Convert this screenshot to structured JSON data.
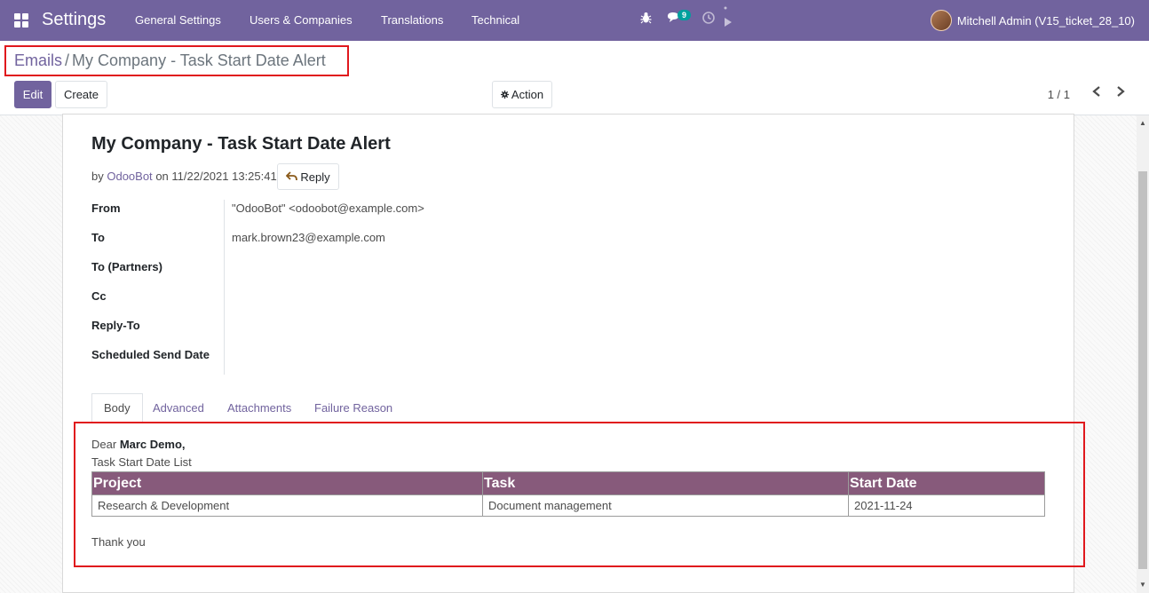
{
  "navbar": {
    "app_title": "Settings",
    "menu": [
      "General Settings",
      "Users & Companies",
      "Translations",
      "Technical"
    ],
    "chat_badge": "9",
    "user_name": "Mitchell Admin (V15_ticket_28_10)",
    "bg_color": "#71639e"
  },
  "breadcrumb": {
    "parent": "Emails",
    "separator": "/",
    "current": "My Company - Task Start Date Alert"
  },
  "toolbar": {
    "edit_label": "Edit",
    "create_label": "Create",
    "action_label": "Action",
    "pager": "1 / 1"
  },
  "message": {
    "title": "My Company - Task Start Date Alert",
    "by_prefix": "by",
    "author": "OdooBot",
    "on_text": "on 11/22/2021 13:25:41",
    "reply_label": "Reply"
  },
  "fields": [
    {
      "label": "From",
      "value": "\"OdooBot\" <odoobot@example.com>"
    },
    {
      "label": "To",
      "value": "mark.brown23@example.com"
    },
    {
      "label": "To (Partners)",
      "value": ""
    },
    {
      "label": "Cc",
      "value": ""
    },
    {
      "label": "Reply-To",
      "value": ""
    },
    {
      "label": "Scheduled Send Date",
      "value": ""
    }
  ],
  "tabs": [
    "Body",
    "Advanced",
    "Attachments",
    "Failure Reason"
  ],
  "body": {
    "greeting_prefix": "Dear",
    "recipient": "Marc Demo,",
    "subtitle": "Task Start Date List",
    "table_headers": [
      "Project",
      "Task",
      "Start Date"
    ],
    "table_rows": [
      [
        "Research & Development",
        "Document management",
        "2021-11-24"
      ]
    ],
    "closing": "Thank you",
    "table_header_color": "#875a7b"
  },
  "icons": {
    "apps": "apps-grid-icon",
    "bug": "bug-icon",
    "chat": "chat-icon",
    "activity": "clock-icon",
    "gear": "gear-icon",
    "prev": "chevron-left-icon",
    "next": "chevron-right-icon",
    "reply": "reply-arrow-icon"
  }
}
